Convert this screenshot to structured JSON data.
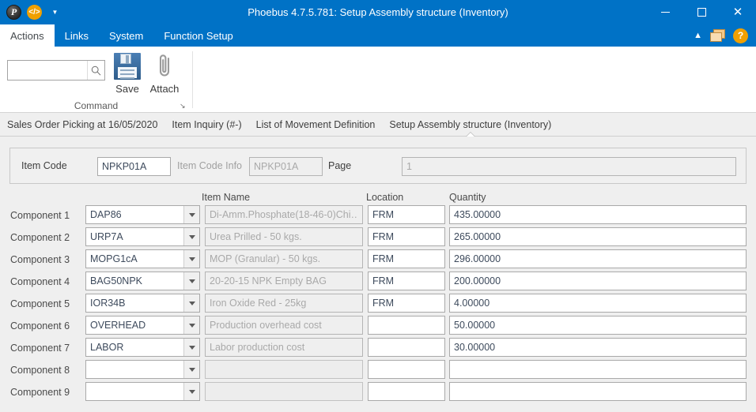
{
  "window": {
    "title": "Phoebus 4.7.5.781: Setup Assembly structure (Inventory)",
    "logo_text": "P",
    "code_icon_text": "</>",
    "qat_more_icon": "chevron-down-icon",
    "minimize_label": "–",
    "maximize_label": "",
    "close_label": "✕",
    "accent_color": "#0072c6"
  },
  "ribbon": {
    "tabs": [
      {
        "label": "Actions",
        "active": true
      },
      {
        "label": "Links",
        "active": false
      },
      {
        "label": "System",
        "active": false
      },
      {
        "label": "Function Setup",
        "active": false
      }
    ],
    "collapse_icon": "chevron-up-icon",
    "windows_icon": "window-stack-icon",
    "help_label": "?",
    "group": {
      "label": "Command",
      "launcher_glyph": "↘",
      "search_value": "",
      "search_placeholder": "",
      "search_icon": "search-icon",
      "buttons": [
        {
          "label": "Save",
          "icon": "floppy-disk-icon"
        },
        {
          "label": "Attach",
          "icon": "paperclip-icon"
        }
      ]
    }
  },
  "breadcrumbs": [
    {
      "label": "Sales Order Picking at 16/05/2020",
      "active": false
    },
    {
      "label": "Item Inquiry (#-)",
      "active": false
    },
    {
      "label": "List of Movement Definition",
      "active": false
    },
    {
      "label": "Setup Assembly structure (Inventory)",
      "active": true
    }
  ],
  "header_panel": {
    "item_code_label": "Item Code",
    "item_code_value": "NPKP01A",
    "item_code_info_label": "Item Code Info",
    "item_code_info_value": "NPKP01A",
    "page_label": "Page",
    "page_value": "1"
  },
  "table": {
    "columns": [
      {
        "key": "component",
        "label": ""
      },
      {
        "key": "code",
        "label": ""
      },
      {
        "key": "item_name",
        "label": "Item Name"
      },
      {
        "key": "location",
        "label": "Location"
      },
      {
        "key": "quantity",
        "label": "Quantity"
      }
    ],
    "rows": [
      {
        "component": "Component 1",
        "code": "DAP86",
        "item_name": "Di-Amm.Phosphate(18-46-0)Chi…",
        "location": "FRM",
        "quantity": "435.00000"
      },
      {
        "component": "Component 2",
        "code": "URP7A",
        "item_name": "Urea Prilled - 50 kgs.",
        "location": "FRM",
        "quantity": "265.00000"
      },
      {
        "component": "Component 3",
        "code": "MOPG1cA",
        "item_name": "MOP (Granular) - 50 kgs.",
        "location": "FRM",
        "quantity": "296.00000"
      },
      {
        "component": "Component 4",
        "code": "BAG50NPK",
        "item_name": "20-20-15 NPK Empty BAG",
        "location": "FRM",
        "quantity": "200.00000"
      },
      {
        "component": "Component 5",
        "code": "IOR34B",
        "item_name": "Iron Oxide Red - 25kg",
        "location": "FRM",
        "quantity": "4.00000"
      },
      {
        "component": "Component 6",
        "code": "OVERHEAD",
        "item_name": "Production overhead cost",
        "location": "",
        "quantity": "50.00000"
      },
      {
        "component": "Component 7",
        "code": "LABOR",
        "item_name": "Labor production cost",
        "location": "",
        "quantity": "30.00000"
      },
      {
        "component": "Component 8",
        "code": "",
        "item_name": "",
        "location": "",
        "quantity": ""
      },
      {
        "component": "Component 9",
        "code": "",
        "item_name": "",
        "location": "",
        "quantity": ""
      }
    ]
  }
}
